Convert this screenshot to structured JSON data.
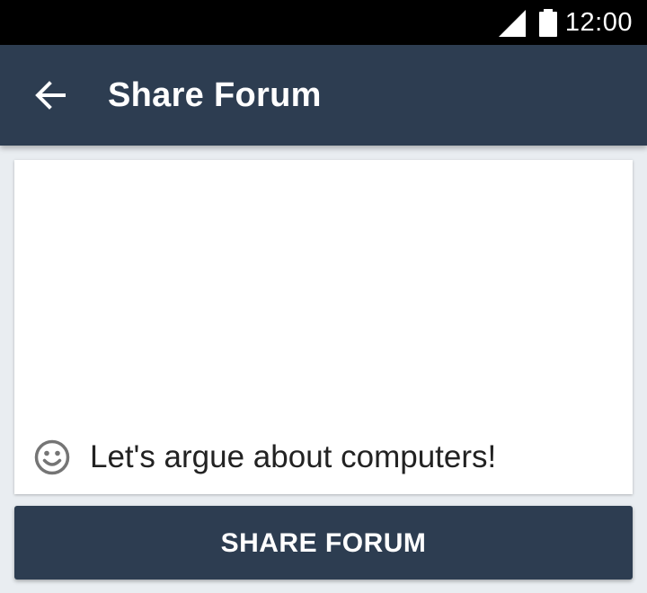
{
  "status_bar": {
    "time": "12:00",
    "signal_icon": "cellular-signal-icon",
    "battery_icon": "battery-full-icon"
  },
  "app_bar": {
    "back_icon": "arrow-back-icon",
    "title": "Share Forum"
  },
  "card": {
    "forum_icon": "smiley-face-icon",
    "forum_name": "Let's argue about computers!"
  },
  "share_button": {
    "label": "SHARE FORUM"
  },
  "colors": {
    "primary": "#2d3d51",
    "background": "#e9edf1",
    "status_bar": "#000000",
    "card": "#ffffff",
    "icon_gray": "#757575"
  }
}
